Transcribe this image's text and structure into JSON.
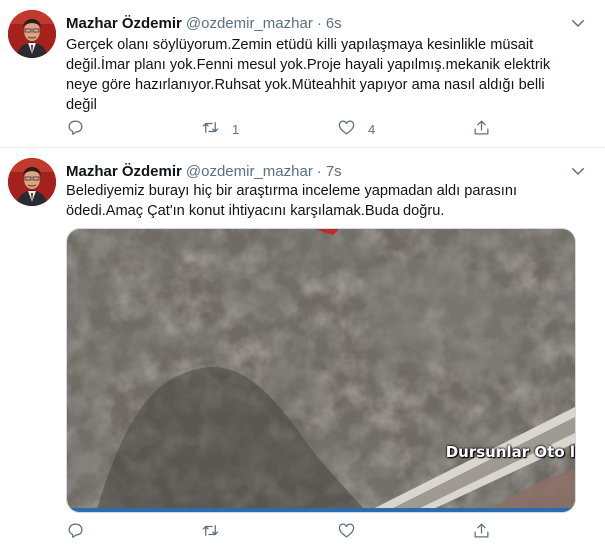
{
  "tweets": [
    {
      "author_name": "Mazhar Özdemir",
      "handle": "@ozdemir_mazhar",
      "separator": "·",
      "time": "6s",
      "text": "Gerçek olanı söylüyorum.Zemin etüdü killi yapılaşmaya kesinlikle müsait değil.İmar planı yok.Fenni mesul yok.Proje hayali yapılmış.mekanik elektrik neye göre hazırlanıyor.Ruhsat yok.Müteahhit yapıyor ama nasıl aldığı belli değil",
      "reply_count": "",
      "retweet_count": "1",
      "like_count": "4"
    },
    {
      "author_name": "Mazhar Özdemir",
      "handle": "@ozdemir_mazhar",
      "separator": "·",
      "time": "7s",
      "text": "Belediyemiz burayı hiç bir araştırma inceleme yapmadan aldı parasını ödedi.Amaç Çat'ın konut ihtiyacını karşılamak.Buda doğru.",
      "media_label": "Dursunlar Oto l",
      "reply_count": "",
      "retweet_count": "",
      "like_count": ""
    }
  ],
  "icons": {
    "reply": "reply-icon",
    "retweet": "retweet-icon",
    "like": "heart-icon",
    "share": "share-icon",
    "caret": "chevron-down-icon"
  },
  "colors": {
    "text": "#0f1419",
    "secondary": "#5b7083",
    "divider": "#e6ecf0"
  }
}
